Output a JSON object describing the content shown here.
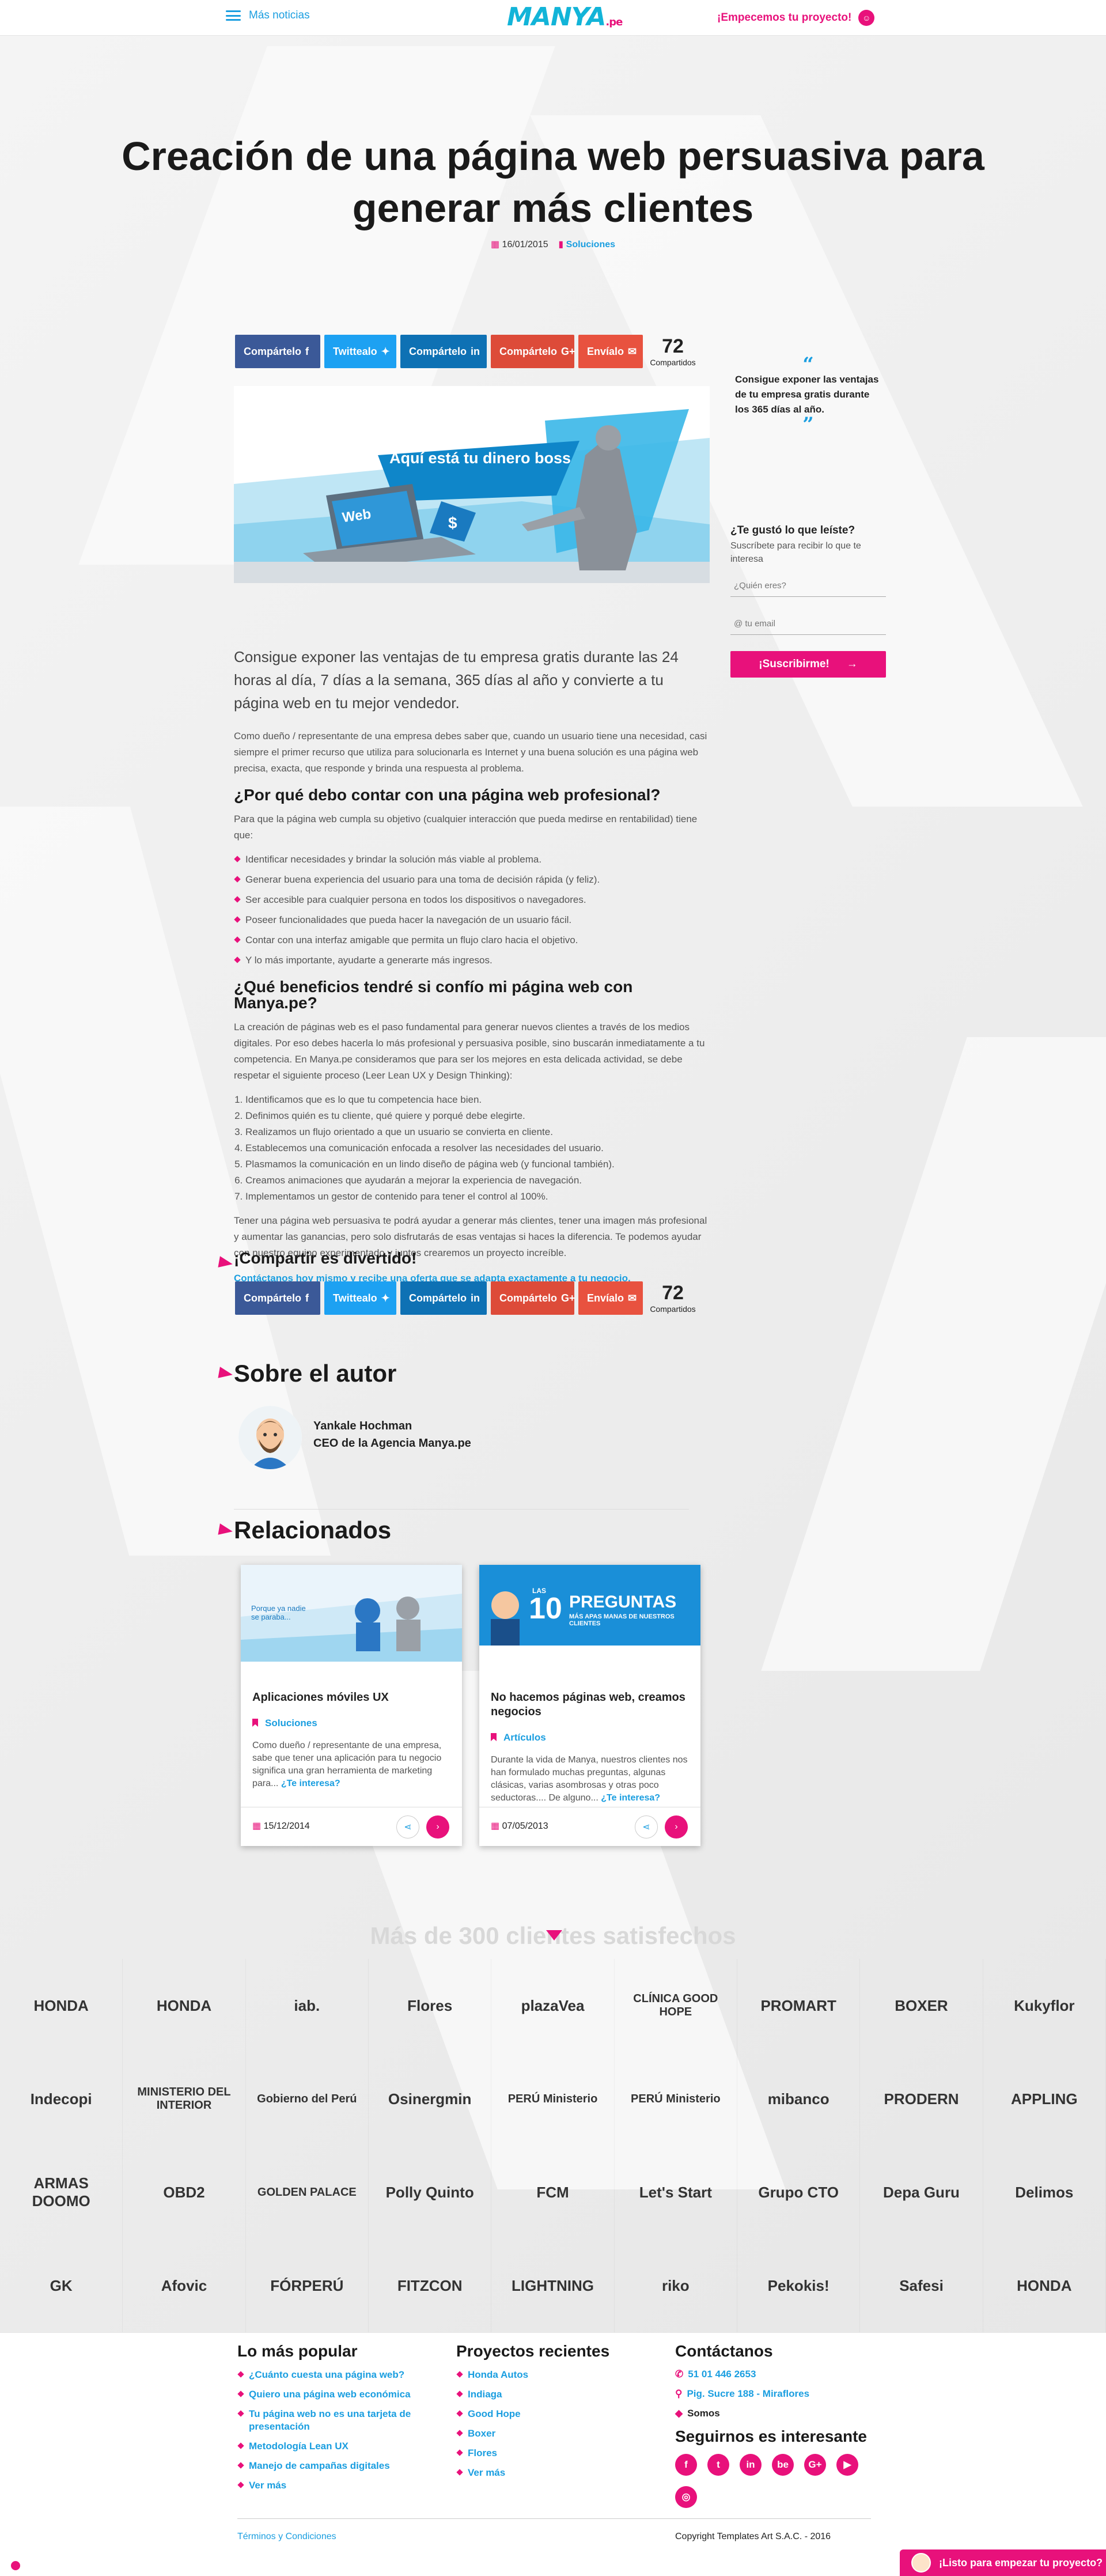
{
  "header": {
    "menu_label": "Más noticias",
    "logo_main": "MANYA",
    "logo_suffix": ".pe",
    "cta": "¡Empecemos tu proyecto!"
  },
  "post": {
    "title": "Creación de una página web persuasiva para generar más clientes",
    "date": "16/01/2015",
    "category": "Soluciones"
  },
  "share": {
    "facebook": "Compártelo",
    "twitter": "Twittealo",
    "linkedin": "Compártelo",
    "gplus": "Compártelo",
    "email": "Envíalo",
    "count": "72",
    "count_label": "Compartidos"
  },
  "hero": {
    "bubble": "Aquí está tu dinero boss",
    "laptop_label": "Web",
    "bag_symbol": "$"
  },
  "article": {
    "lead": "Consigue exponer las ventajas de tu empresa gratis durante las 24 horas al día, 7 días a la semana, 365 días al año y convierte a tu página web en tu mejor vendedor.",
    "intro": "Como dueño / representante de una empresa debes saber que, cuando un usuario tiene una necesidad, casi siempre el primer recurso que utiliza para solucionarla es Internet y una buena solución es una página web precisa, exacta, que responde y brinda una respuesta al problema.",
    "h2_1": "¿Por qué debo contar con una página web profesional?",
    "p1": "Para que la página web cumpla su objetivo (cualquier interacción que pueda medirse en rentabilidad) tiene que:",
    "list1": [
      "Identificar necesidades y brindar la solución más viable al problema.",
      "Generar buena experiencia del usuario para una toma de decisión rápida (y feliz).",
      "Ser accesible para cualquier persona en todos los dispositivos o navegadores.",
      "Poseer funcionalidades que pueda hacer la navegación de un usuario fácil.",
      "Contar con una interfaz amigable que permita un flujo claro hacia el objetivo.",
      "Y lo más importante, ayudarte a generarte más ingresos."
    ],
    "h2_2": "¿Qué beneficios tendré si confío mi página web con Manya.pe?",
    "p2": "La creación de páginas web es el paso fundamental para generar nuevos clientes a través de los medios digitales. Por eso debes hacerla lo más profesional y persuasiva posible, sino buscarán inmediatamente a tu competencia. En Manya.pe consideramos que para ser los mejores en esta delicada actividad, se debe respetar el siguiente proceso (Leer Lean UX y Design Thinking):",
    "list2": [
      "Identificamos que es lo que tu competencia hace bien.",
      "Definimos quién es tu cliente, qué quiere y porqué debe elegirte.",
      "Realizamos un flujo orientado a que un usuario se convierta en cliente.",
      "Establecemos una comunicación enfocada a resolver las necesidades del usuario.",
      "Plasmamos la comunicación en un lindo diseño de página web (y funcional también).",
      "Creamos animaciones que ayudarán a mejorar la experiencia de navegación.",
      "Implementamos un gestor de contenido para tener el control al 100%."
    ],
    "p3": "Tener una página web persuasiva te podrá ayudar a generar más clientes, tener una imagen más profesional y aumentar las ganancias, pero solo disfrutarás de esas ventajas si haces la diferencia. Te podemos ayudar con nuestro equipo experimentado y juntos crearemos un proyecto increíble.",
    "cta": "Contáctanos hoy mismo y recibe una oferta que se adapta exactamente a tu negocio."
  },
  "sidebar": {
    "quote": "Consigue exponer las ventajas de tu empresa gratis durante los 365 días al año.",
    "nl_title": "¿Te gustó lo que leíste?",
    "nl_text": "Suscríbete para recibir lo que te interesa",
    "name_ph": "¿Quién eres?",
    "email_ph": "@ tu email",
    "btn": "¡Suscribirme!"
  },
  "sections": {
    "share_fun": "¡Compartir es divertido!",
    "author": "Sobre el autor",
    "related": "Relacionados",
    "clients": "Más de 300 clientes satisfechos"
  },
  "author": {
    "name": "Yankale Hochman",
    "role": "CEO de la Agencia Manya.pe"
  },
  "related": [
    {
      "title": "Aplicaciones móviles UX",
      "category": "Soluciones",
      "excerpt": "Como dueño / representante de una empresa, sabe que tener una aplicación para tu negocio significa una gran herramienta de marketing para...",
      "more": "¿Te interesa?",
      "date": "15/12/2014",
      "img_text": "Porque ya nadie se paraba..."
    },
    {
      "title": "No hacemos páginas web, creamos negocios",
      "category": "Artículos",
      "excerpt": "Durante la vida de Manya, nuestros clientes nos han formulado muchas preguntas, algunas clásicas, varias asombrosas y otras poco seductoras.... De alguno...",
      "more": "¿Te interesa?",
      "date": "07/05/2013",
      "img_top": "LAS",
      "img_num": "10",
      "img_big": "PREGUNTAS",
      "img_small": "MÁS APAS MANAS DE NUESTROS CLIENTES"
    }
  ],
  "clients": [
    "HONDA",
    "HONDA",
    "iab.",
    "Flores",
    "plazaVea",
    "CLÍNICA GOOD HOPE",
    "PROMART",
    "BOXER",
    "Kukyflor",
    "Indecopi",
    "MINISTERIO DEL INTERIOR",
    "Gobierno del Perú",
    "Osinergmin",
    "PERÚ Ministerio",
    "PERÚ Ministerio",
    "mibanco",
    "PRODERN",
    "APPLING",
    "ARMAS DOOMO",
    "OBD2",
    "GOLDEN PALACE",
    "Polly Quinto",
    "FCM",
    "Let's Start",
    "Grupo CTO",
    "Depa Guru",
    "Delimos",
    "GK",
    "Afovic",
    "FÓRPERÚ",
    "FITZCON",
    "LIGHTNING",
    "riko",
    "Pekokis!",
    "Safesi",
    "HONDA"
  ],
  "footer": {
    "popular_h": "Lo más popular",
    "popular": [
      "¿Cuánto cuesta una página web?",
      "Quiero una página web económica",
      "Tu página web no es una tarjeta de presentación",
      "Metodología Lean UX",
      "Manejo de campañas digitales",
      "Ver más"
    ],
    "projects_h": "Proyectos recientes",
    "projects": [
      "Honda Autos",
      "Indiaga",
      "Good Hope",
      "Boxer",
      "Flores",
      "Ver más"
    ],
    "contact_h": "Contáctanos",
    "phone": "51 01 446 2653",
    "address": "Pig. Sucre 188 - Miraflores",
    "about": "Somos",
    "social_h": "Seguirnos es interesante",
    "social": [
      "f",
      "t",
      "in",
      "be",
      "G+",
      "▶",
      "◎"
    ],
    "terms": "Términos y Condiciones",
    "copyright": "Copyright Templates Art S.A.C. - 2016",
    "float_cta": "¡Listo para empezar tu proyecto?"
  },
  "colors": {
    "pink": "#e8117b",
    "blue": "#1a9ee0",
    "facebook": "#3b5998",
    "twitter": "#1da1f2",
    "linkedin": "#0e71b4",
    "gplus": "#dd4b39"
  }
}
